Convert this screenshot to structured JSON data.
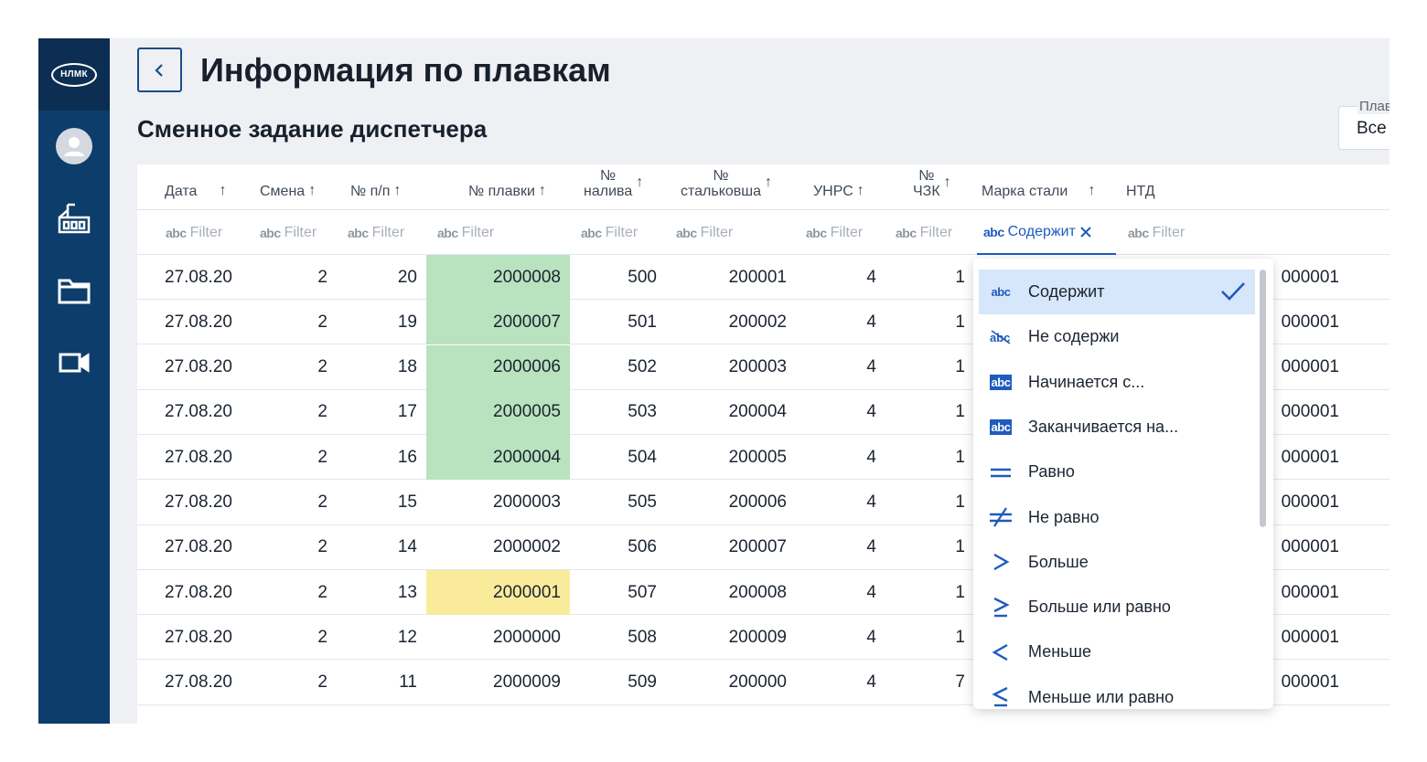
{
  "app": {
    "logo_text": "НЛМК"
  },
  "header": {
    "title": "Информация по плавкам",
    "subtitle": "Сменное задание диспетчера",
    "plav_label": "Плав",
    "plav_value": "Все"
  },
  "table": {
    "columns": [
      {
        "label": "Дата",
        "label2": ""
      },
      {
        "label": "Смена",
        "label2": ""
      },
      {
        "label": "№ п/п",
        "label2": ""
      },
      {
        "label": "№ плавки",
        "label2": ""
      },
      {
        "label": "№",
        "label2": "налива"
      },
      {
        "label": "№",
        "label2": "стальковша"
      },
      {
        "label": "УНРС",
        "label2": ""
      },
      {
        "label": "№",
        "label2": "ЧЗК"
      },
      {
        "label": "Марка стали",
        "label2": ""
      },
      {
        "label": "НТД",
        "label2": ""
      }
    ],
    "filter_placeholder": "Filter",
    "active_filter_label": "Содержит",
    "rows": [
      [
        "27.08.20",
        "2",
        "20",
        "2000008",
        "500",
        "200001",
        "4",
        "1",
        "000001"
      ],
      [
        "27.08.20",
        "2",
        "19",
        "2000007",
        "501",
        "200002",
        "4",
        "1",
        "000001"
      ],
      [
        "27.08.20",
        "2",
        "18",
        "2000006",
        "502",
        "200003",
        "4",
        "1",
        "000001"
      ],
      [
        "27.08.20",
        "2",
        "17",
        "2000005",
        "503",
        "200004",
        "4",
        "1",
        "000001"
      ],
      [
        "27.08.20",
        "2",
        "16",
        "2000004",
        "504",
        "200005",
        "4",
        "1",
        "000001"
      ],
      [
        "27.08.20",
        "2",
        "15",
        "2000003",
        "505",
        "200006",
        "4",
        "1",
        "000001"
      ],
      [
        "27.08.20",
        "2",
        "14",
        "2000002",
        "506",
        "200007",
        "4",
        "1",
        "000001"
      ],
      [
        "27.08.20",
        "2",
        "13",
        "2000001",
        "507",
        "200008",
        "4",
        "1",
        "000001"
      ],
      [
        "27.08.20",
        "2",
        "12",
        "2000000",
        "508",
        "200009",
        "4",
        "1",
        "000001"
      ],
      [
        "27.08.20",
        "2",
        "11",
        "2000009",
        "509",
        "200000",
        "4",
        "7",
        "000001"
      ]
    ],
    "highlight_green_rows": [
      0,
      1,
      2,
      3,
      4
    ],
    "highlight_yellow_rows": [
      7
    ]
  },
  "filter_menu": {
    "items": [
      {
        "label": "Содержит",
        "icon": "contains-icon",
        "selected": true
      },
      {
        "label": "Не содержи",
        "icon": "not-contains-icon",
        "selected": false
      },
      {
        "label": "Начинается с...",
        "icon": "starts-with-icon",
        "selected": false
      },
      {
        "label": "Заканчивается на...",
        "icon": "ends-with-icon",
        "selected": false
      },
      {
        "label": "Равно",
        "icon": "equals-icon",
        "selected": false
      },
      {
        "label": "Не равно",
        "icon": "not-equals-icon",
        "selected": false
      },
      {
        "label": "Больше",
        "icon": "greater-icon",
        "selected": false
      },
      {
        "label": "Больше или равно",
        "icon": "greater-equal-icon",
        "selected": false
      },
      {
        "label": "Меньше",
        "icon": "less-icon",
        "selected": false
      },
      {
        "label": "Меньше или равно",
        "icon": "less-equal-icon",
        "selected": false
      }
    ]
  },
  "colors": {
    "sidebar": "#0d3d6b",
    "accent": "#1d5bbf",
    "highlight_green": "#b9e2be",
    "highlight_yellow": "#faeb9b"
  }
}
